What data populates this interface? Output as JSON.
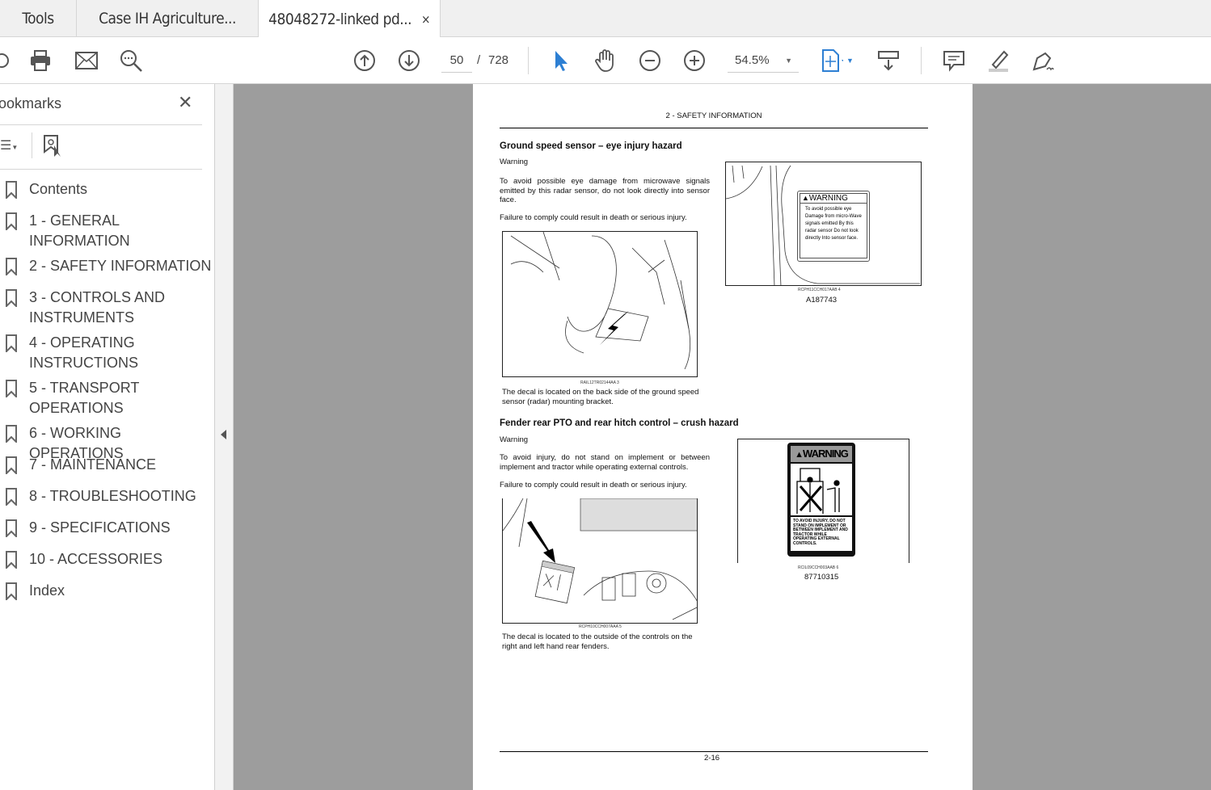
{
  "tabs": [
    {
      "label": "Tools"
    },
    {
      "label": "Case IH Agriculture..."
    },
    {
      "label": "48048272-linked pd...",
      "close": "×"
    }
  ],
  "toolbar": {
    "page_current": "50",
    "page_sep": "/",
    "page_total": "728",
    "zoom": "54.5%"
  },
  "sidebar": {
    "title": "ookmarks",
    "close": "✕",
    "items": [
      {
        "label": "Contents"
      },
      {
        "label": "1 - GENERAL INFORMATION"
      },
      {
        "label": "2 - SAFETY INFORMATION"
      },
      {
        "label": "3 - CONTROLS AND INSTRUMENTS"
      },
      {
        "label": "4 - OPERATING INSTRUCTIONS"
      },
      {
        "label": "5 - TRANSPORT OPERATIONS"
      },
      {
        "label": "6 - WORKING OPERATIONS"
      },
      {
        "label": "7 - MAINTENANCE"
      },
      {
        "label": "8 - TROUBLESHOOTING"
      },
      {
        "label": "9 - SPECIFICATIONS"
      },
      {
        "label": "10 - ACCESSORIES"
      },
      {
        "label": "Index"
      }
    ]
  },
  "doc": {
    "header": "2 - SAFETY INFORMATION",
    "footer": "2-16",
    "s1": {
      "title": "Ground speed sensor – eye injury hazard",
      "kind": "Warning",
      "p1": "To avoid possible eye damage from microwave signals emitted by this radar sensor, do not look directly into sensor face.",
      "p2": "Failure to comply could result in death or serious injury.",
      "fig3_code": "RAIL12TR02144AA   3",
      "fig3_caption": "The decal is located on the back side of the ground speed sensor (radar) mounting bracket.",
      "decal_title": "WARNING",
      "decal_text": "To avoid possible eye Damage from micro-Wave signals emitted By this radar sensor Do not look directly Into sensor face.",
      "fig4_code": "RCPH11CCH017AAB   4",
      "fig4_part": "A187743"
    },
    "s2": {
      "title": "Fender rear PTO and rear hitch control – crush hazard",
      "kind": "Warning",
      "p1": "To avoid injury, do not stand on implement or between implement and tractor while operating external controls.",
      "p2": "Failure to comply could result in death or serious injury.",
      "fig5_code": "RCPH10CCH007AAA   5",
      "fig5_caption": "The decal is located to the outside of the controls on the right and left hand rear fenders.",
      "decal_title": "WARNING",
      "decal_text": "TO AVOID INJURY, DO NOT STAND ON IMPLEMENT OR BETWEEN IMPLEMENT AND TRACTOR WHILE OPERATING EXTERNAL CONTROLS.",
      "fig6_code": "RCIL09CCH003AAB   6",
      "fig6_part": "87710315"
    }
  },
  "colors": {
    "accent": "#2d7fd3",
    "viewer_bg": "#9d9d9d"
  }
}
